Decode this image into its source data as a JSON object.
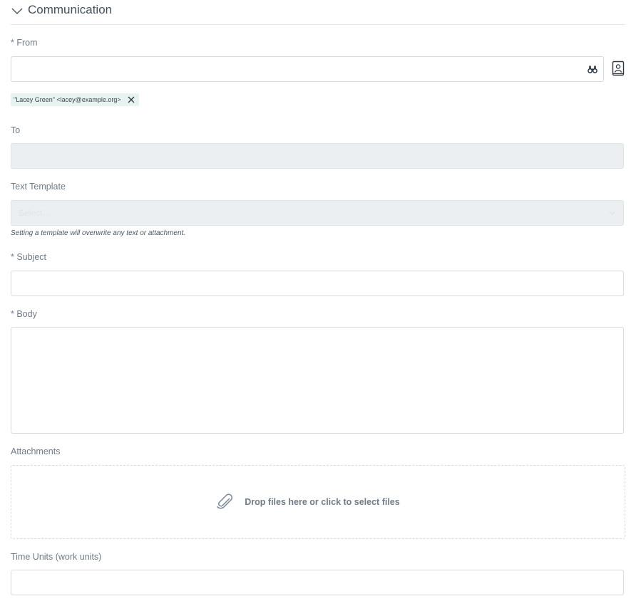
{
  "section": {
    "title": "Communication"
  },
  "from": {
    "label": "* From",
    "value": "",
    "selected_recipient": "\"Lacey Green\" <lacey@example.org>"
  },
  "to": {
    "label": "To",
    "value": ""
  },
  "text_template": {
    "label": "Text Template",
    "placeholder": "Select...",
    "hint": "Setting a template will overwrite any text or attachment."
  },
  "subject": {
    "label": "* Subject",
    "value": ""
  },
  "body": {
    "label": "* Body",
    "value": ""
  },
  "attachments": {
    "label": "Attachments",
    "dropzone_text": "Drop files here or click to select files"
  },
  "time_units": {
    "label": "Time Units (work units)",
    "value": ""
  },
  "icons": {
    "collapse": "chevron-down-icon",
    "search": "binoculars-icon",
    "address_book": "address-book-icon",
    "remove": "close-icon",
    "attach": "paperclip-icon"
  }
}
